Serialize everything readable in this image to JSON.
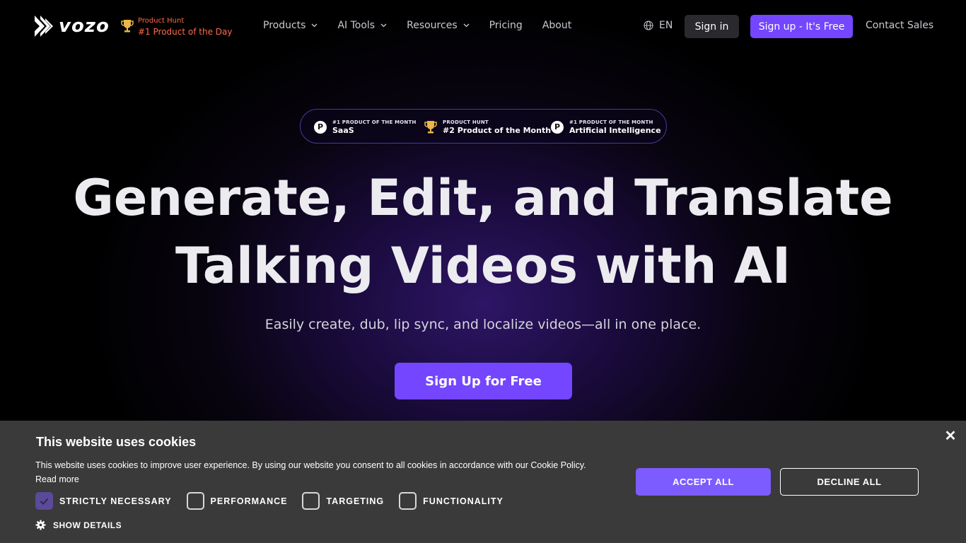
{
  "colors": {
    "accent": "#7446ff",
    "award_text": "#ff6b4a",
    "cookie_bg": "#3a3a3a"
  },
  "nav": {
    "logo_text": "vozo",
    "ph_badge": {
      "small": "Product Hunt",
      "big": "#1 Product of the Day",
      "icon": "trophy-icon"
    },
    "items": [
      {
        "label": "Products",
        "has_dropdown": true
      },
      {
        "label": "AI Tools",
        "has_dropdown": true
      },
      {
        "label": "Resources",
        "has_dropdown": true
      },
      {
        "label": "Pricing",
        "has_dropdown": false
      },
      {
        "label": "About",
        "has_dropdown": false
      }
    ],
    "language": "EN",
    "signin_label": "Sign in",
    "signup_label": "Sign up - It's Free",
    "contact_label": "Contact Sales"
  },
  "awards": [
    {
      "small": "#1 PRODUCT OF THE MONTH",
      "big": "SaaS",
      "icon": "P"
    },
    {
      "small": "PRODUCT HUNT",
      "big": "#2 Product of the Month",
      "icon": "trophy-icon"
    },
    {
      "small": "#1 PRODUCT OF THE MONTH",
      "big": "Artificial Intelligence",
      "icon": "P"
    }
  ],
  "hero": {
    "title_line1": "Generate, Edit, and Translate",
    "title_line2": "Talking Videos with AI",
    "subtitle": "Easily create, dub, lip sync, and localize videos—all in one place.",
    "cta_label": "Sign Up for Free"
  },
  "cookie": {
    "title": "This website uses cookies",
    "text": "This website uses cookies to improve user experience. By using our website you consent to all cookies in accordance with our Cookie Policy.",
    "read_more": "Read more",
    "close": "✕",
    "options": [
      {
        "label": "STRICTLY NECESSARY",
        "checked": true
      },
      {
        "label": "PERFORMANCE",
        "checked": false
      },
      {
        "label": "TARGETING",
        "checked": false
      },
      {
        "label": "FUNCTIONALITY",
        "checked": false
      }
    ],
    "show_details": "SHOW DETAILS",
    "accept_label": "ACCEPT ALL",
    "decline_label": "DECLINE ALL"
  }
}
